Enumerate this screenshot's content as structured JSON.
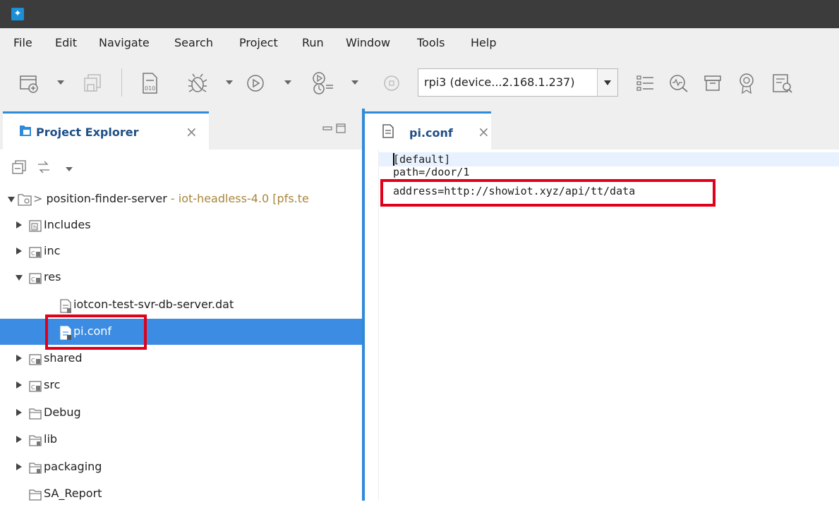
{
  "menu": [
    "File",
    "Edit",
    "Navigate",
    "Search",
    "Project",
    "Run",
    "Window",
    "Tools",
    "Help"
  ],
  "toolbar": {
    "target_device": "rpi3 (device...2.168.1.237)"
  },
  "project_explorer": {
    "tab_label": "Project Explorer",
    "project": {
      "prefix": "> ",
      "name": "position-finder-server",
      "decoration": " - iot-headless-4.0  [pfs.te"
    },
    "tree": [
      {
        "label": "Includes",
        "state": "collapsed",
        "icon": "includes-icon"
      },
      {
        "label": "inc",
        "state": "collapsed",
        "icon": "source-folder-icon"
      },
      {
        "label": "res",
        "state": "expanded",
        "icon": "source-folder-icon"
      },
      {
        "label": "iotcon-test-svr-db-server.dat",
        "state": "leaf",
        "icon": "file-icon"
      },
      {
        "label": "pi.conf",
        "state": "selected",
        "icon": "file-icon"
      },
      {
        "label": "shared",
        "state": "collapsed",
        "icon": "source-folder-icon"
      },
      {
        "label": "src",
        "state": "collapsed",
        "icon": "source-folder-icon"
      },
      {
        "label": "Debug",
        "state": "collapsed",
        "icon": "folder-icon"
      },
      {
        "label": "lib",
        "state": "collapsed",
        "icon": "folder-icon"
      },
      {
        "label": "packaging",
        "state": "collapsed",
        "icon": "folder-icon"
      },
      {
        "label": "SA_Report",
        "state": "leaf",
        "icon": "folder-icon"
      }
    ]
  },
  "editor": {
    "tab_label": "pi.conf",
    "lines": [
      "[default]",
      "path=/door/1",
      "address=http://showiot.xyz/api/tt/data"
    ]
  },
  "colors": {
    "accent": "#2f8ad7",
    "selection": "#3b8ce2",
    "highlight_box": "#e1001a",
    "title_bar": "#3c3c3c"
  }
}
